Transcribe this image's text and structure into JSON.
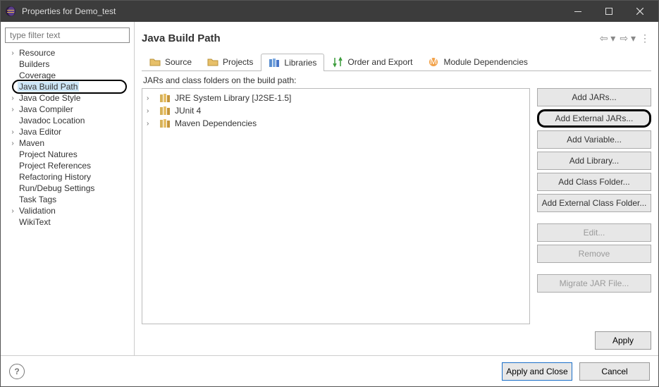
{
  "window": {
    "title": "Properties for Demo_test"
  },
  "sidebar": {
    "filter_placeholder": "type filter text",
    "items": [
      {
        "label": "Resource",
        "expandable": true
      },
      {
        "label": "Builders",
        "expandable": false
      },
      {
        "label": "Coverage",
        "expandable": false
      },
      {
        "label": "Java Build Path",
        "expandable": false,
        "selected": true,
        "highlight": true
      },
      {
        "label": "Java Code Style",
        "expandable": true
      },
      {
        "label": "Java Compiler",
        "expandable": true
      },
      {
        "label": "Javadoc Location",
        "expandable": false
      },
      {
        "label": "Java Editor",
        "expandable": true
      },
      {
        "label": "Maven",
        "expandable": true
      },
      {
        "label": "Project Natures",
        "expandable": false
      },
      {
        "label": "Project References",
        "expandable": false
      },
      {
        "label": "Refactoring History",
        "expandable": false
      },
      {
        "label": "Run/Debug Settings",
        "expandable": false
      },
      {
        "label": "Task Tags",
        "expandable": false
      },
      {
        "label": "Validation",
        "expandable": true
      },
      {
        "label": "WikiText",
        "expandable": false
      }
    ]
  },
  "main": {
    "title": "Java Build Path",
    "tabs": [
      {
        "label": "Source",
        "icon": "folder"
      },
      {
        "label": "Projects",
        "icon": "folder"
      },
      {
        "label": "Libraries",
        "icon": "lib",
        "active": true
      },
      {
        "label": "Order and Export",
        "icon": "order"
      },
      {
        "label": "Module Dependencies",
        "icon": "module"
      }
    ],
    "hint": "JARs and class folders on the build path:",
    "lib_entries": [
      {
        "label": "JRE System Library [J2SE-1.5]"
      },
      {
        "label": "JUnit 4"
      },
      {
        "label": "Maven Dependencies"
      }
    ],
    "buttons": {
      "add_jars": "Add JARs...",
      "add_external_jars": "Add External JARs...",
      "add_variable": "Add Variable...",
      "add_library": "Add Library...",
      "add_class_folder": "Add Class Folder...",
      "add_external_class_folder": "Add External Class Folder...",
      "edit": "Edit...",
      "remove": "Remove",
      "migrate": "Migrate JAR File..."
    },
    "apply": "Apply"
  },
  "footer": {
    "apply_close": "Apply and Close",
    "cancel": "Cancel"
  }
}
